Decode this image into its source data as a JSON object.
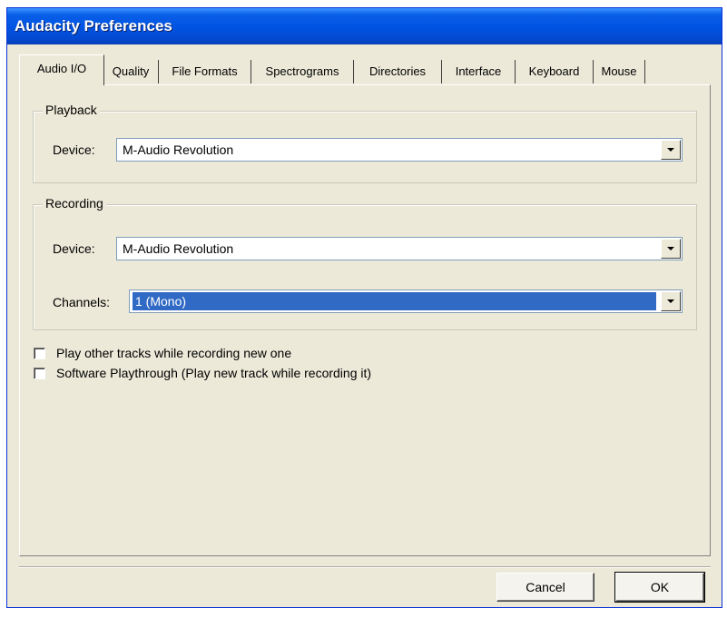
{
  "window": {
    "title": "Audacity Preferences"
  },
  "tabs": [
    {
      "label": "Audio I/O",
      "active": true
    },
    {
      "label": "Quality"
    },
    {
      "label": "File Formats"
    },
    {
      "label": "Spectrograms"
    },
    {
      "label": "Directories"
    },
    {
      "label": "Interface"
    },
    {
      "label": "Keyboard"
    },
    {
      "label": "Mouse"
    }
  ],
  "playback": {
    "group_label": "Playback",
    "device_label": "Device:",
    "device_value": "M-Audio Revolution"
  },
  "recording": {
    "group_label": "Recording",
    "device_label": "Device:",
    "device_value": "M-Audio Revolution",
    "channels_label": "Channels:",
    "channels_value": "1 (Mono)"
  },
  "options": [
    {
      "label": "Play other tracks while recording new one",
      "checked": false
    },
    {
      "label": "Software Playthrough (Play new track while recording it)",
      "checked": false
    }
  ],
  "buttons": {
    "cancel": "Cancel",
    "ok": "OK"
  },
  "colors": {
    "titlebar": "#0054e3",
    "dialog_bg": "#ece9d8",
    "selection": "#316ac5"
  }
}
